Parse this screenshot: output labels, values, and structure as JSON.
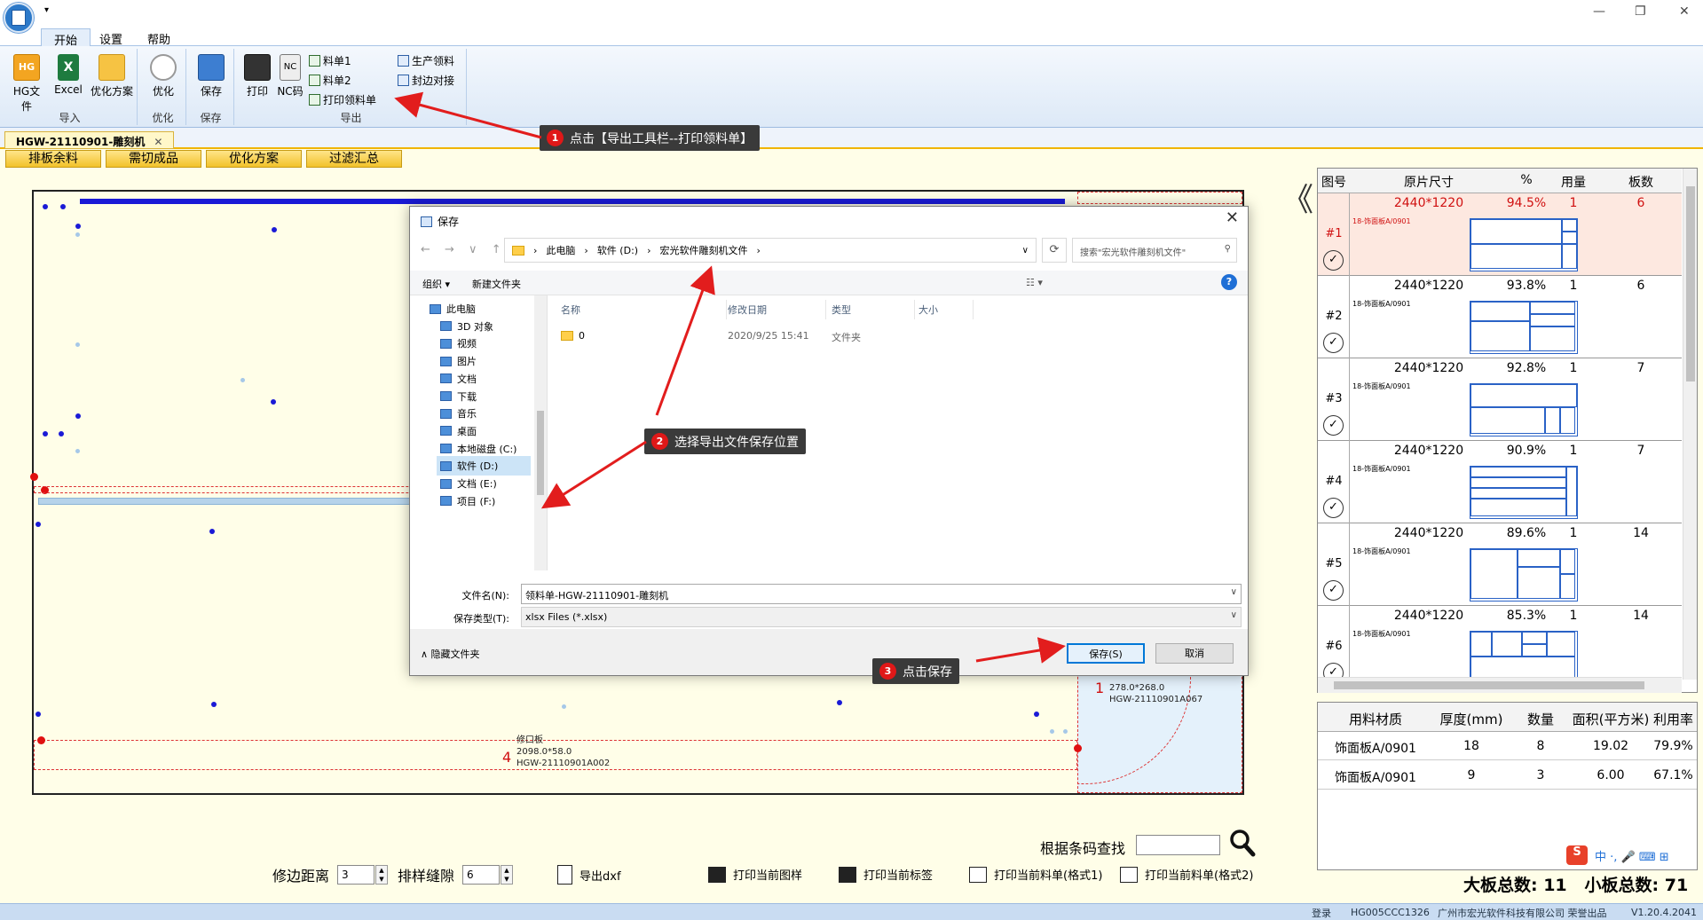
{
  "titlebar": {
    "qat_glyph": "▾",
    "min": "—",
    "restore": "❐",
    "close": "✕"
  },
  "ribbon_tabs": [
    "开始",
    "设置",
    "帮助"
  ],
  "ribbon": {
    "import_group": {
      "label": "导入",
      "hg": "HG文件",
      "excel": "Excel",
      "plan": "优化方案"
    },
    "optimize_group": {
      "label": "优化",
      "btn": "优化"
    },
    "save_group": {
      "label": "保存",
      "btn": "保存"
    },
    "export_group": {
      "label": "导出",
      "print": "打印",
      "nc": "NC码",
      "m1": "料单1",
      "m2": "料单2",
      "print_list": "打印领料单",
      "prod": "生产领料",
      "edge": "封边对接"
    }
  },
  "doc_tab": {
    "label": "HGW-21110901-雕刻机",
    "close": "✕"
  },
  "sub_tabs": [
    "排板余料",
    "需切成品",
    "优化方案",
    "过滤汇总"
  ],
  "canvas": {
    "piece1": {
      "num": "1",
      "size": "278.0*268.0",
      "code": "HGW-21110901A067"
    },
    "piece4": {
      "num": "4",
      "name": "修口板",
      "size": "2098.0*58.0",
      "code": "HGW-21110901A002"
    }
  },
  "collapse_arrow": "《",
  "right_table": {
    "headers": [
      "图号",
      "原片尺寸",
      "%",
      "用量",
      "板数"
    ],
    "rows": [
      {
        "id": "#1",
        "size": "2440*1220",
        "pct": "94.5%",
        "qty": "1",
        "count": "6",
        "mat": "18-饰面板A/0901"
      },
      {
        "id": "#2",
        "size": "2440*1220",
        "pct": "93.8%",
        "qty": "1",
        "count": "6",
        "mat": "18-饰面板A/0901"
      },
      {
        "id": "#3",
        "size": "2440*1220",
        "pct": "92.8%",
        "qty": "1",
        "count": "7",
        "mat": "18-饰面板A/0901"
      },
      {
        "id": "#4",
        "size": "2440*1220",
        "pct": "90.9%",
        "qty": "1",
        "count": "7",
        "mat": "18-饰面板A/0901"
      },
      {
        "id": "#5",
        "size": "2440*1220",
        "pct": "89.6%",
        "qty": "1",
        "count": "14",
        "mat": "18-饰面板A/0901"
      },
      {
        "id": "#6",
        "size": "2440*1220",
        "pct": "85.3%",
        "qty": "1",
        "count": "14",
        "mat": "18-饰面板A/0901"
      }
    ],
    "check_glyph": "✓"
  },
  "stats_table": {
    "headers": [
      "用料材质",
      "厚度(mm)",
      "数量",
      "面积(平方米)",
      "利用率"
    ],
    "rows": [
      [
        "饰面板A/0901",
        "18",
        "8",
        "19.02",
        "79.9%"
      ],
      [
        "饰面板A/0901",
        "9",
        "3",
        "6.00",
        "67.1%"
      ]
    ]
  },
  "totals": {
    "big": "大板总数: 11",
    "small": "小板总数: 71"
  },
  "barcode_search": {
    "label": "根据条码查找",
    "value": ""
  },
  "bottom": {
    "edge_label": "修边距离",
    "edge_value": "3",
    "gap_label": "排样缝隙",
    "gap_value": "6",
    "export_dxf": "导出dxf",
    "print_pattern": "打印当前图样",
    "print_label": "打印当前标签",
    "print_list1": "打印当前料单(格式1)",
    "print_list2": "打印当前料单(格式2)"
  },
  "statusbar": {
    "login": "登录",
    "code": "HG005CCC1326",
    "company": "广州市宏光软件科技有限公司 荣誉出品",
    "version": "V1.20.4.2041"
  },
  "dialog": {
    "title": "保存",
    "close": "✕",
    "nav": "←  →  ∨  ↑",
    "breadcrumb": [
      "此电脑",
      "软件 (D:)",
      "宏光软件雕刻机文件"
    ],
    "search_placeholder": "搜索\"宏光软件雕刻机文件\"",
    "organize": "组织 ▾",
    "new_folder": "新建文件夹",
    "help": "?",
    "tree": [
      "此电脑",
      "3D 对象",
      "视频",
      "图片",
      "文档",
      "下载",
      "音乐",
      "桌面",
      "本地磁盘 (C:)",
      "软件 (D:)",
      "文档 (E:)",
      "项目 (F:)"
    ],
    "list_headers": [
      "名称",
      "修改日期",
      "类型",
      "大小"
    ],
    "list_rows": [
      {
        "name": "0",
        "date": "2020/9/25 15:41",
        "type": "文件夹",
        "size": ""
      }
    ],
    "filename_label": "文件名(N):",
    "filename": "领料单-HGW-21110901-雕刻机",
    "filetype_label": "保存类型(T):",
    "filetype": "xlsx Files (*.xlsx)",
    "hide_folders": "∧  隐藏文件夹",
    "save_btn": "保存(S)",
    "cancel_btn": "取消"
  },
  "callouts": [
    {
      "n": "1",
      "text": "点击【导出工具栏--打印领料单】"
    },
    {
      "n": "2",
      "text": "选择导出文件保存位置"
    },
    {
      "n": "3",
      "text": "点击保存"
    }
  ],
  "ime": {
    "s": "S",
    "items": "中 ·, 🎤 ⌨ ⊞"
  }
}
